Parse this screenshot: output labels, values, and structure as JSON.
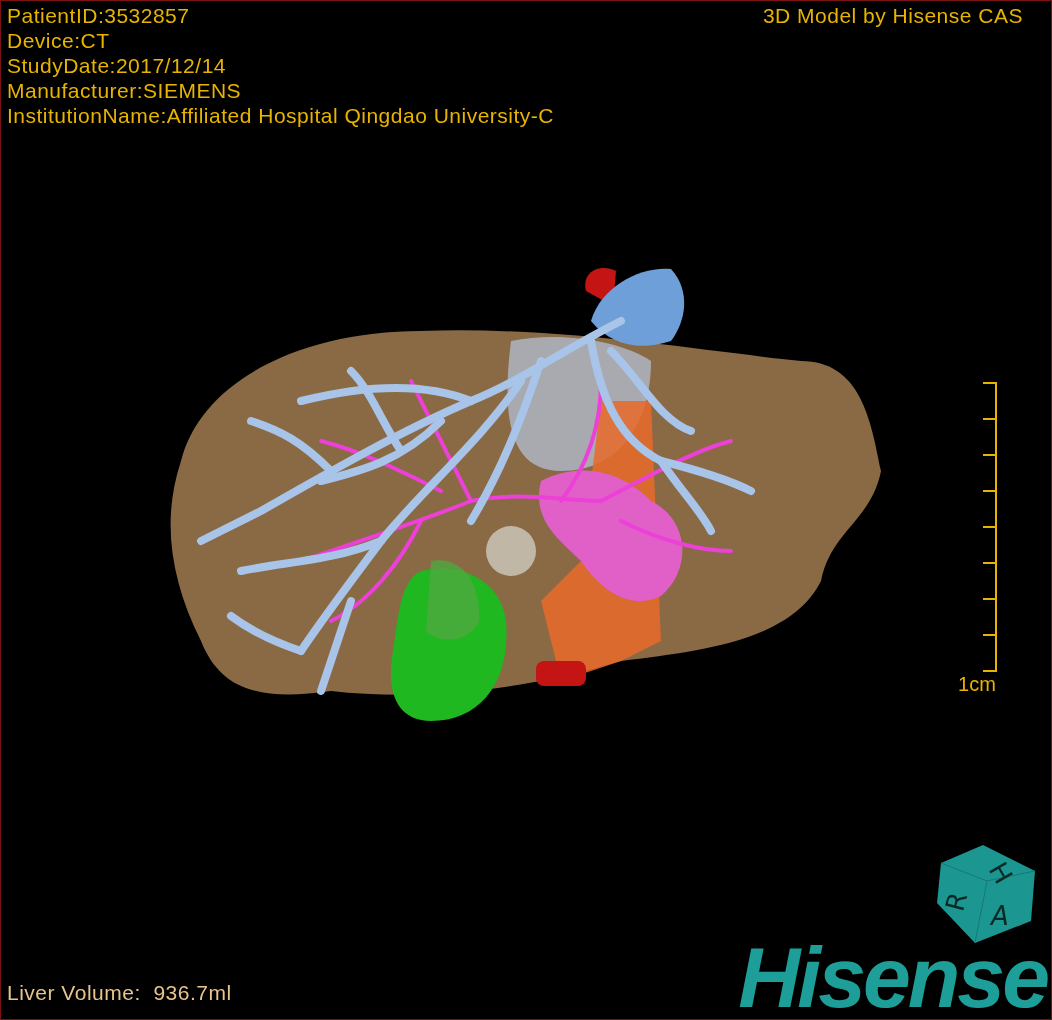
{
  "viewport": {
    "info_lines": [
      "PatientID:3532857",
      "Device:CT",
      "StudyDate:2017/12/14",
      "Manufacturer:SIEMENS",
      "InstitutionName:Affiliated Hospital Qingdao University-C"
    ],
    "title": "3D Model by Hisense CAS",
    "scale_bar": {
      "label": "1cm"
    },
    "orientation_cube": {
      "faces": [
        "H",
        "R",
        "A"
      ]
    },
    "logo": "Hisense",
    "liver_volume": "Liver Volume:  936.7ml"
  }
}
